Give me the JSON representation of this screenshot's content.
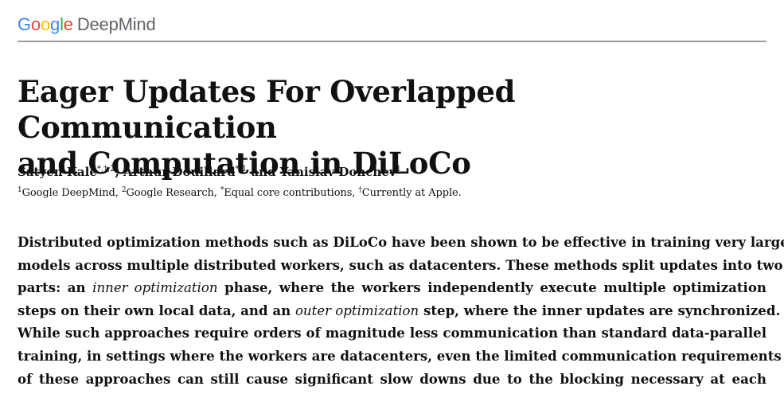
{
  "header": {
    "logo": {
      "google_letters": [
        "G",
        "o",
        "o",
        "g",
        "l",
        "e"
      ],
      "deepmind": "DeepMind"
    }
  },
  "paper": {
    "title_line1": "Eager Updates For Overlapped Communication",
    "title_line2": "and Computation in DiLoCo",
    "authors": [
      {
        "name": "Satyen Kale",
        "marks": "*,†,2"
      },
      {
        "name": "Arthur Douillard",
        "marks": "*,1"
      },
      {
        "name": "Yanislav Donchev",
        "marks": "1"
      }
    ],
    "author_separator_1": ", ",
    "author_separator_2": " and ",
    "affiliations": [
      {
        "mark": "1",
        "text": "Google DeepMind, "
      },
      {
        "mark": "2",
        "text": "Google Research, "
      },
      {
        "mark": "*",
        "text": "Equal core contributions, "
      },
      {
        "mark": "†",
        "text": "Currently at Apple."
      }
    ],
    "abstract": {
      "l1": "Distributed optimization methods such as DiLoCo have been shown to be effective in training very large",
      "l2": "models across multiple distributed workers, such as datacenters. These methods split updates into two",
      "l3_a": "parts: an ",
      "l3_em": "inner optimization",
      "l3_b": " phase, where the workers independently execute multiple optimization",
      "l4_a": "steps on their own local data, and an ",
      "l4_em": "outer optimization",
      "l4_b": " step, where the inner updates are synchronized.",
      "l5": "While such approaches require orders of magnitude less communication than standard data-parallel",
      "l6": "training, in settings where the workers are datacenters, even the limited communication requirements",
      "l7": "of these approaches can still cause significant slow downs due to the blocking necessary at each"
    }
  }
}
